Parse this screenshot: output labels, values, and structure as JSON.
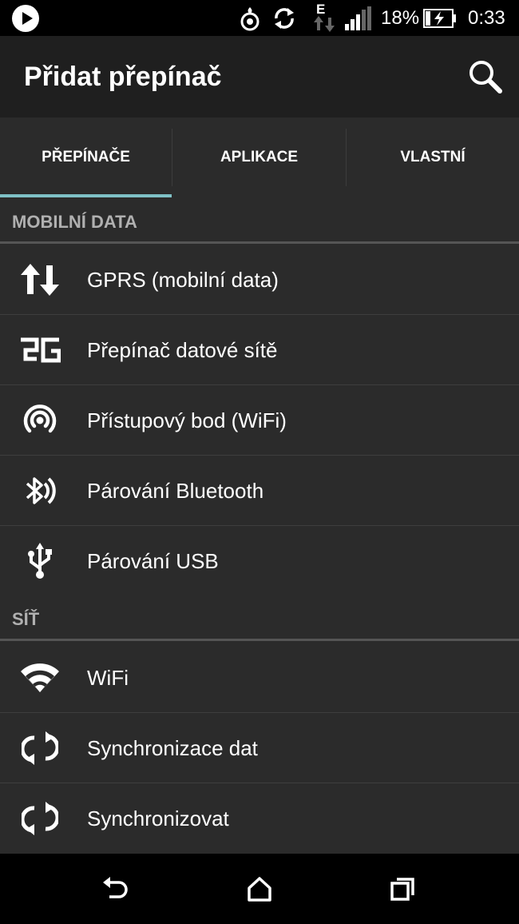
{
  "status_bar": {
    "network_type": "E",
    "battery_percent": "18%",
    "time": "0:33"
  },
  "app_bar": {
    "title": "Přidat přepínač",
    "search_icon": "search-icon"
  },
  "tabs": [
    {
      "label": "PŘEPÍNAČE",
      "selected": true
    },
    {
      "label": "APLIKACE",
      "selected": false
    },
    {
      "label": "VLASTNÍ",
      "selected": false
    }
  ],
  "sections": [
    {
      "title": "MOBILNÍ DATA",
      "items": [
        {
          "label": "GPRS (mobilní data)",
          "icon": "data-arrows-icon"
        },
        {
          "label": "Přepínač datové sítě",
          "icon": "2g-icon"
        },
        {
          "label": "Přístupový bod (WiFi)",
          "icon": "hotspot-icon"
        },
        {
          "label": "Párování Bluetooth",
          "icon": "bluetooth-tethering-icon"
        },
        {
          "label": "Párování USB",
          "icon": "usb-icon"
        }
      ]
    },
    {
      "title": "SÍŤ",
      "items": [
        {
          "label": "WiFi",
          "icon": "wifi-icon"
        },
        {
          "label": "Synchronizace dat",
          "icon": "sync-icon"
        },
        {
          "label": "Synchronizovat",
          "icon": "sync-icon"
        }
      ]
    }
  ],
  "nav_bar": {
    "back": "back-icon",
    "home": "home-icon",
    "recents": "recents-icon"
  }
}
